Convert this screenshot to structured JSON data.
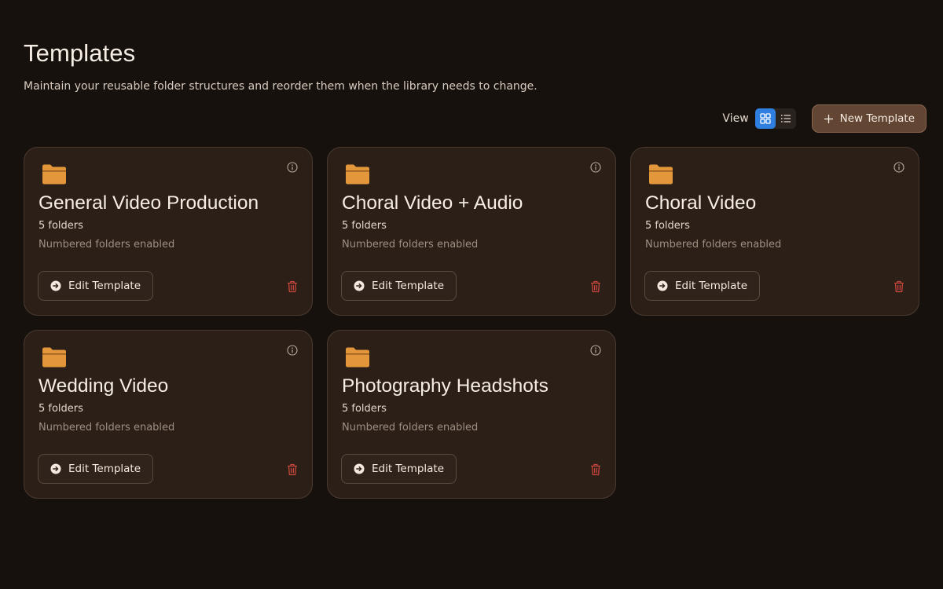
{
  "header": {
    "title": "Templates",
    "subtitle": "Maintain your reusable folder structures and reorder them when the library needs to change."
  },
  "toolbar": {
    "view_label": "View",
    "view_modes": [
      {
        "icon": "grid-icon",
        "active": true
      },
      {
        "icon": "list-icon",
        "active": false
      }
    ],
    "new_button_label": "New Template",
    "new_button_icon": "plus-icon"
  },
  "colors": {
    "background": "#17110d",
    "card": "#2b1f18",
    "accent_active": "#2f7fe0",
    "folder": "#e4973a",
    "danger": "#c8473d",
    "primary_button": "#634534"
  },
  "templates": [
    {
      "name": "General Video Production",
      "count": "5 folders",
      "numbered": "Numbered folders enabled",
      "edit_label": "Edit Template"
    },
    {
      "name": "Choral Video + Audio",
      "count": "5 folders",
      "numbered": "Numbered folders enabled",
      "edit_label": "Edit Template"
    },
    {
      "name": "Choral Video",
      "count": "5 folders",
      "numbered": "Numbered folders enabled",
      "edit_label": "Edit Template"
    },
    {
      "name": "Wedding Video",
      "count": "5 folders",
      "numbered": "Numbered folders enabled",
      "edit_label": "Edit Template"
    },
    {
      "name": "Photography Headshots",
      "count": "5 folders",
      "numbered": "Numbered folders enabled",
      "edit_label": "Edit Template"
    }
  ]
}
